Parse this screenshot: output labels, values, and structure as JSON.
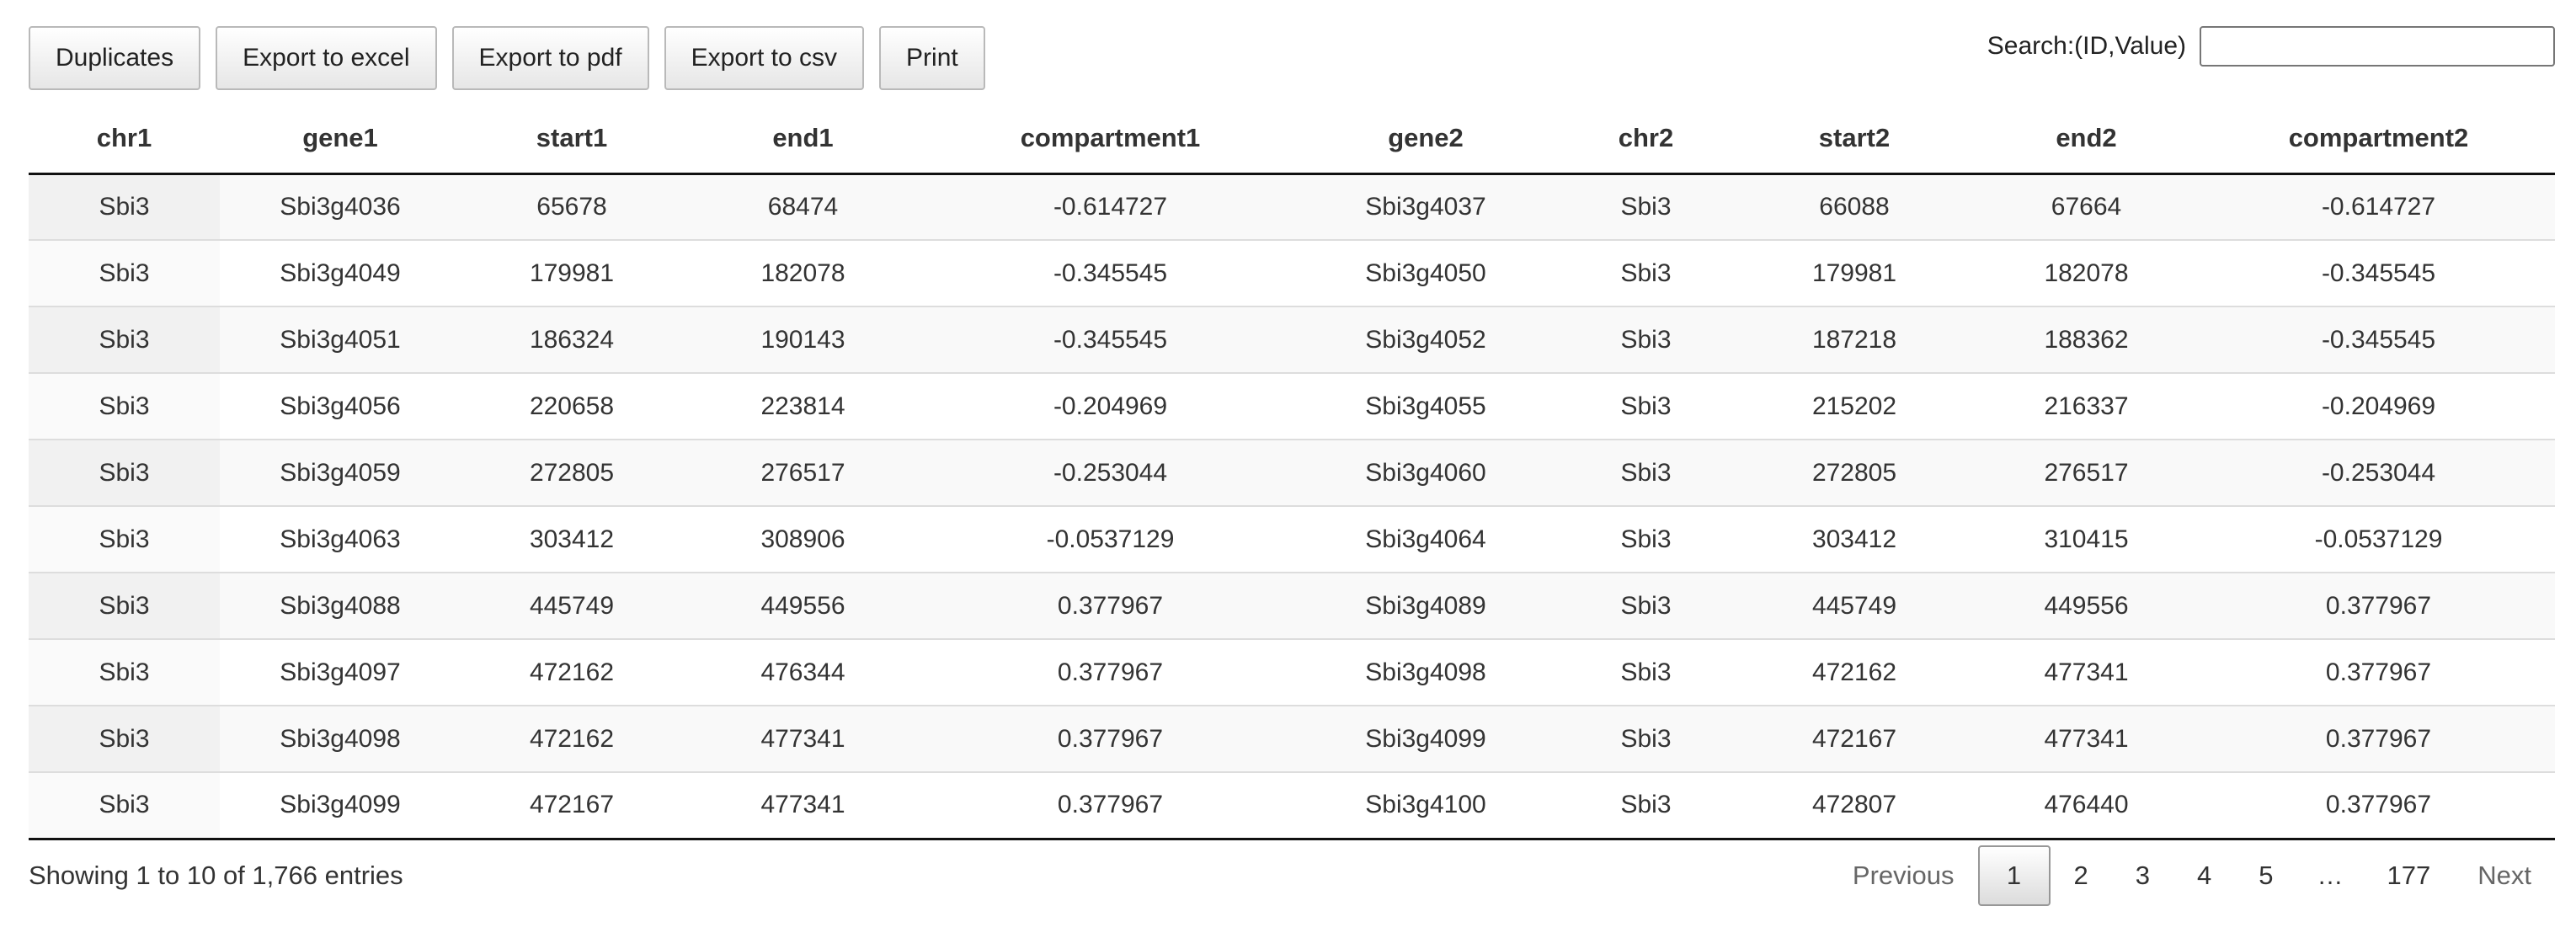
{
  "toolbar": {
    "buttons": [
      "Duplicates",
      "Export to excel",
      "Export to pdf",
      "Export to csv",
      "Print"
    ]
  },
  "search": {
    "label": "Search:(ID,Value)",
    "value": "",
    "placeholder": ""
  },
  "table": {
    "columns": [
      "chr1",
      "gene1",
      "start1",
      "end1",
      "compartment1",
      "gene2",
      "chr2",
      "start2",
      "end2",
      "compartment2"
    ],
    "rows": [
      [
        "Sbi3",
        "Sbi3g4036",
        "65678",
        "68474",
        "-0.614727",
        "Sbi3g4037",
        "Sbi3",
        "66088",
        "67664",
        "-0.614727"
      ],
      [
        "Sbi3",
        "Sbi3g4049",
        "179981",
        "182078",
        "-0.345545",
        "Sbi3g4050",
        "Sbi3",
        "179981",
        "182078",
        "-0.345545"
      ],
      [
        "Sbi3",
        "Sbi3g4051",
        "186324",
        "190143",
        "-0.345545",
        "Sbi3g4052",
        "Sbi3",
        "187218",
        "188362",
        "-0.345545"
      ],
      [
        "Sbi3",
        "Sbi3g4056",
        "220658",
        "223814",
        "-0.204969",
        "Sbi3g4055",
        "Sbi3",
        "215202",
        "216337",
        "-0.204969"
      ],
      [
        "Sbi3",
        "Sbi3g4059",
        "272805",
        "276517",
        "-0.253044",
        "Sbi3g4060",
        "Sbi3",
        "272805",
        "276517",
        "-0.253044"
      ],
      [
        "Sbi3",
        "Sbi3g4063",
        "303412",
        "308906",
        "-0.0537129",
        "Sbi3g4064",
        "Sbi3",
        "303412",
        "310415",
        "-0.0537129"
      ],
      [
        "Sbi3",
        "Sbi3g4088",
        "445749",
        "449556",
        "0.377967",
        "Sbi3g4089",
        "Sbi3",
        "445749",
        "449556",
        "0.377967"
      ],
      [
        "Sbi3",
        "Sbi3g4097",
        "472162",
        "476344",
        "0.377967",
        "Sbi3g4098",
        "Sbi3",
        "472162",
        "477341",
        "0.377967"
      ],
      [
        "Sbi3",
        "Sbi3g4098",
        "472162",
        "477341",
        "0.377967",
        "Sbi3g4099",
        "Sbi3",
        "472167",
        "477341",
        "0.377967"
      ],
      [
        "Sbi3",
        "Sbi3g4099",
        "472167",
        "477341",
        "0.377967",
        "Sbi3g4100",
        "Sbi3",
        "472807",
        "476440",
        "0.377967"
      ]
    ]
  },
  "footer": {
    "info": "Showing 1 to 10 of 1,766 entries",
    "pagination": {
      "previous": "Previous",
      "pages": [
        "1",
        "2",
        "3",
        "4",
        "5",
        "…",
        "177"
      ],
      "current": "1",
      "next": "Next"
    }
  }
}
